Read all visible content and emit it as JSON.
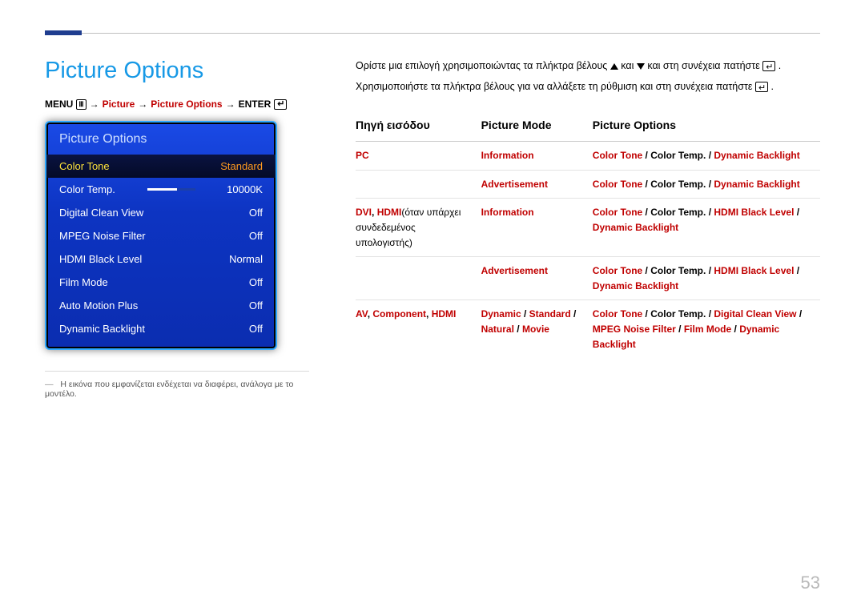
{
  "page_title": "Picture Options",
  "page_number": "53",
  "breadcrumb": {
    "menu": "MENU",
    "picture": "Picture",
    "picture_options": "Picture Options",
    "enter": "ENTER"
  },
  "osd": {
    "title": "Picture Options",
    "rows": [
      {
        "label": "Color Tone",
        "value": "Standard",
        "selected": true
      },
      {
        "label": "Color Temp.",
        "value": "10000K",
        "slider": true
      },
      {
        "label": "Digital Clean View",
        "value": "Off"
      },
      {
        "label": "MPEG Noise Filter",
        "value": "Off"
      },
      {
        "label": "HDMI Black Level",
        "value": "Normal"
      },
      {
        "label": "Film Mode",
        "value": "Off"
      },
      {
        "label": "Auto Motion Plus",
        "value": "Off"
      },
      {
        "label": "Dynamic Backlight",
        "value": "Off"
      }
    ]
  },
  "note": {
    "dash": "―",
    "text": "Η εικόνα που εμφανίζεται ενδέχεται να διαφέρει, ανάλογα με το μοντέλο."
  },
  "intro": {
    "line1_a": "Ορίστε μια επιλογή χρησιμοποιώντας τα πλήκτρα βέλους ",
    "line1_mid": " και ",
    "line1_b": " και στη συνέχεια πατήστε ",
    "line1_end": ".",
    "line2_a": "Χρησιμοποιήστε τα πλήκτρα βέλους για να αλλάξετε τη ρύθμιση και στη συνέχεια πατήστε ",
    "line2_end": "."
  },
  "table": {
    "headers": {
      "source": "Πηγή εισόδου",
      "mode": "Picture Mode",
      "options": "Picture Options"
    },
    "rows": [
      {
        "source_html": [
          {
            "t": "PC",
            "c": "red"
          }
        ],
        "mode_html": [
          {
            "t": "Information",
            "c": "red"
          }
        ],
        "options_html": [
          {
            "t": "Color Tone",
            "c": "red"
          },
          {
            "t": " / ",
            "c": "sep"
          },
          {
            "t": "Color Temp.",
            "c": "blk"
          },
          {
            "t": " / ",
            "c": "sep"
          },
          {
            "t": "Dynamic Backlight",
            "c": "red"
          }
        ]
      },
      {
        "source_html": [],
        "mode_html": [
          {
            "t": "Advertisement",
            "c": "red"
          }
        ],
        "options_html": [
          {
            "t": "Color Tone",
            "c": "red"
          },
          {
            "t": " / ",
            "c": "sep"
          },
          {
            "t": "Color Temp.",
            "c": "blk"
          },
          {
            "t": " / ",
            "c": "sep"
          },
          {
            "t": "Dynamic Backlight",
            "c": "red"
          }
        ]
      },
      {
        "source_html": [
          {
            "t": "DVI",
            "c": "red"
          },
          {
            "t": ", ",
            "c": "blk"
          },
          {
            "t": "HDMI",
            "c": "red"
          },
          {
            "t": "(όταν υπάρχει συνδεδεμένος υπολογιστής)",
            "c": "plain"
          }
        ],
        "mode_html": [
          {
            "t": "Information",
            "c": "red"
          }
        ],
        "options_html": [
          {
            "t": "Color Tone",
            "c": "red"
          },
          {
            "t": " / ",
            "c": "sep"
          },
          {
            "t": "Color Temp.",
            "c": "blk"
          },
          {
            "t": " / ",
            "c": "sep"
          },
          {
            "t": "HDMI Black Level",
            "c": "red"
          },
          {
            "t": " / ",
            "c": "sep"
          },
          {
            "t": "Dynamic Backlight",
            "c": "red"
          }
        ]
      },
      {
        "source_html": [],
        "mode_html": [
          {
            "t": "Advertisement",
            "c": "red"
          }
        ],
        "options_html": [
          {
            "t": "Color Tone",
            "c": "red"
          },
          {
            "t": " / ",
            "c": "sep"
          },
          {
            "t": "Color Temp.",
            "c": "blk"
          },
          {
            "t": " / ",
            "c": "sep"
          },
          {
            "t": "HDMI Black Level",
            "c": "red"
          },
          {
            "t": " / ",
            "c": "sep"
          },
          {
            "t": "Dynamic Backlight",
            "c": "red"
          }
        ]
      },
      {
        "source_html": [
          {
            "t": "AV",
            "c": "red"
          },
          {
            "t": ", ",
            "c": "blk"
          },
          {
            "t": "Component",
            "c": "red"
          },
          {
            "t": ", ",
            "c": "blk"
          },
          {
            "t": "HDMI",
            "c": "red"
          }
        ],
        "mode_html": [
          {
            "t": "Dynamic",
            "c": "red"
          },
          {
            "t": " / ",
            "c": "sep"
          },
          {
            "t": "Standard",
            "c": "red"
          },
          {
            "t": " / ",
            "c": "sep"
          },
          {
            "t": "Natural",
            "c": "red"
          },
          {
            "t": " / ",
            "c": "sep"
          },
          {
            "t": "Movie",
            "c": "red"
          }
        ],
        "options_html": [
          {
            "t": "Color Tone",
            "c": "red"
          },
          {
            "t": " / ",
            "c": "sep"
          },
          {
            "t": "Color Temp.",
            "c": "blk"
          },
          {
            "t": " / ",
            "c": "sep"
          },
          {
            "t": "Digital Clean View",
            "c": "red"
          },
          {
            "t": " / ",
            "c": "sep"
          },
          {
            "t": "MPEG Noise Filter",
            "c": "red"
          },
          {
            "t": " / ",
            "c": "sep"
          },
          {
            "t": "Film Mode",
            "c": "red"
          },
          {
            "t": " / ",
            "c": "sep"
          },
          {
            "t": "Dynamic Backlight",
            "c": "red"
          }
        ]
      }
    ]
  }
}
